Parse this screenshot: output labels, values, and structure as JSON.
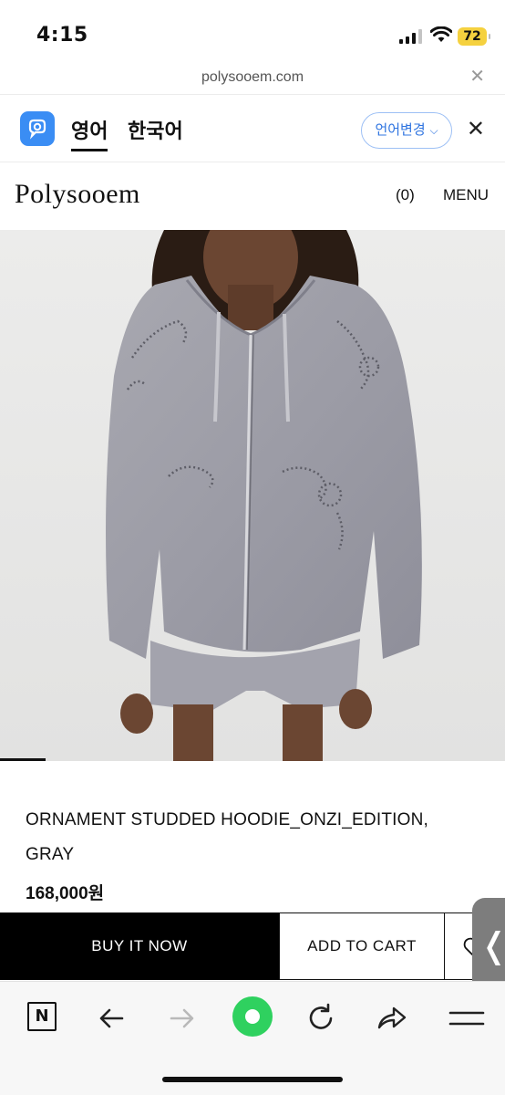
{
  "status_bar": {
    "time": "4:15",
    "battery": "72",
    "battery_color": "#f5d13f"
  },
  "browser": {
    "url": "polysooem.com",
    "close_icon": "close-icon"
  },
  "translate_bar": {
    "source_lang": "영어",
    "target_lang": "한국어",
    "change_label": "언어변경",
    "accent": "#2f74e0"
  },
  "site": {
    "logo": "Polysooem",
    "cart_count": "(0)",
    "menu_label": "MENU"
  },
  "product": {
    "name": "ORNAMENT STUDDED HOODIE_ONZI_EDITION, GRAY",
    "price": "168,000원",
    "image_alt": "model wearing gray studded zip hoodie"
  },
  "actions": {
    "buy_now": "BUY IT NOW",
    "add_to_cart": "ADD TO CART"
  },
  "toolbar": {
    "items": [
      "naver-n-icon",
      "back-arrow-icon",
      "forward-arrow-icon",
      "green-circle-icon",
      "refresh-icon",
      "share-icon",
      "menu-icon"
    ]
  }
}
